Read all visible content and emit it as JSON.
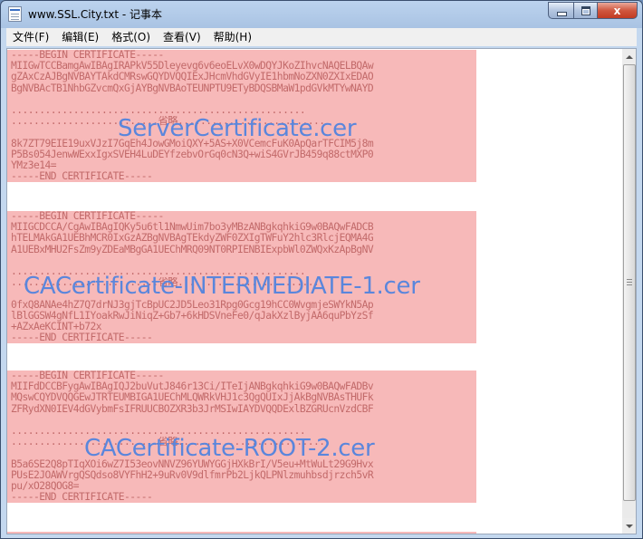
{
  "window": {
    "title": "www.SSL.City.txt - 记事本",
    "close_glyph": "x"
  },
  "menu": [
    "文件(F)",
    "编辑(E)",
    "格式(O)",
    "查看(V)",
    "帮助(H)"
  ],
  "blocks": [
    {
      "lines": [
        "-----BEGIN CERTIFICATE-----",
        "MIIGwTCCBamgAwIBAgIRAPkV55Dleyevg6v6eoELvX0wDQYJKoZIhvcNAQELBQAw",
        "gZAxCzAJBgNVBAYTAkdCMRswGQYDVQQIExJHcmVhdGVyIE1hbmNoZXN0ZXIxEDAO",
        "BgNVBAcTB1NhbGZvcmQxGjAYBgNVBAoTEUNPTU9ETyBDQSBMaW1pdGVkMTYwNAYD",
        "",
        "....................................................",
        "..........................省略..........................",
        "",
        "8k7ZT79EIE19uxVJzI7GqEh4JowGMoiQXY+5AS+X0VCemcFuK0ApQarTFCIM5j8m",
        "P5Bs054JenwWExxIgxSVEH4LuDEYfzebvOrGq0cN3Q+wiS4GVrJB459q88ctMXP0",
        "YMz3e14=",
        "-----END CERTIFICATE-----"
      ],
      "overlay": "ServerCertificate.cer"
    },
    {
      "lines": [
        "-----BEGIN CERTIFICATE-----",
        "MIIGCDCCA/CgAwIBAgIQKy5u6tl1NmwUim7bo3yMBzANBgkqhkiG9w0BAQwFADCB",
        "hTELMAkGA1UEBhMCR0IxGzAZBgNVBAgTEkdyZWF0ZXIgTWFuY2hlc3RlcjEQMA4G",
        "A1UEBxMHU2FsZm9yZDEaMBgGA1UEChMRQ09NT0RPIENBIExpbWl0ZWQxKzApBgNV",
        "",
        "....................................................",
        "..........................省略..........................",
        "",
        "0fxQ8ANAe4hZ7Q7drNJ3gjTcBpUC2JD5Leo31Rpg0Gcg19hCC0WvgmjeSWYkN5Ap",
        "lBlGGSW4gNfL1IYoakRwJiNiqZ+Gb7+6kHDSVneFe0/qJakXzlByjAA6quPbYzSf",
        "+AZxAeKCINT+b72x",
        "-----END CERTIFICATE-----"
      ],
      "overlay": "CACertificate-INTERMEDIATE-1.cer"
    },
    {
      "lines": [
        "-----BEGIN CERTIFICATE-----",
        "MIIFdDCCBFygAwIBAgIQJ2buVutJ846r13Ci/ITeIjANBgkqhkiG9w0BAQwFADBv",
        "MQswCQYDVQQGEwJTRTEUMBIGA1UEChMLQWRkVHJ1c3QgQUIxJjAkBgNVBAsTHUFk",
        "ZFRydXN0IEV4dGVybmFsIFRUUCBOZXR3b3JrMSIwIAYDVQQDExlBZGRUcnVzdCBF",
        "",
        "....................................................",
        "..........................省略..........................",
        "",
        "B5a6SE2Q8pTIqXOi6wZ7I53eovNNVZ96YUWYGGjHXkBrI/V5eu+MtWuLt29G9Hvx",
        "PUsE2JOAWVrgQSQdso8VYFhH2+9uRv0V9dlfmrPb2LjkQLPNlzmuhbsdjrzch5vR",
        "pu/xO28QOG8=",
        "-----END CERTIFICATE-----"
      ],
      "overlay": "CACertificate-ROOT-2.cer"
    }
  ]
}
